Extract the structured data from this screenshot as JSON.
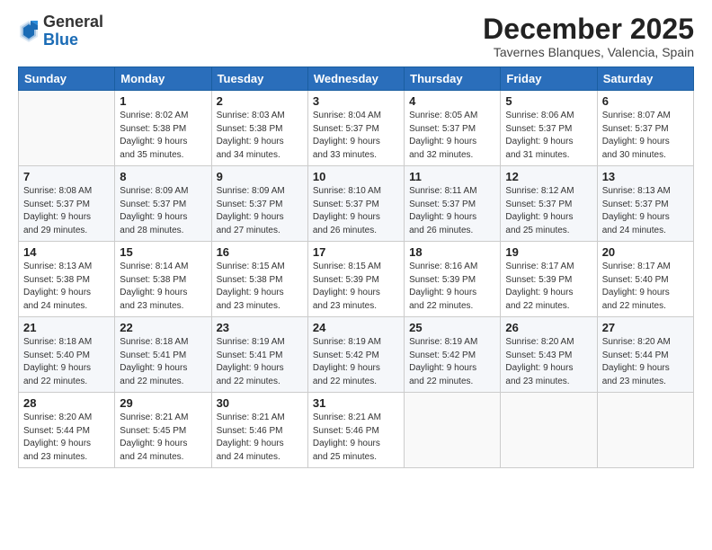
{
  "header": {
    "logo_general": "General",
    "logo_blue": "Blue",
    "month_title": "December 2025",
    "location": "Tavernes Blanques, Valencia, Spain"
  },
  "weekdays": [
    "Sunday",
    "Monday",
    "Tuesday",
    "Wednesday",
    "Thursday",
    "Friday",
    "Saturday"
  ],
  "weeks": [
    [
      {
        "day": "",
        "info": ""
      },
      {
        "day": "1",
        "info": "Sunrise: 8:02 AM\nSunset: 5:38 PM\nDaylight: 9 hours\nand 35 minutes."
      },
      {
        "day": "2",
        "info": "Sunrise: 8:03 AM\nSunset: 5:38 PM\nDaylight: 9 hours\nand 34 minutes."
      },
      {
        "day": "3",
        "info": "Sunrise: 8:04 AM\nSunset: 5:37 PM\nDaylight: 9 hours\nand 33 minutes."
      },
      {
        "day": "4",
        "info": "Sunrise: 8:05 AM\nSunset: 5:37 PM\nDaylight: 9 hours\nand 32 minutes."
      },
      {
        "day": "5",
        "info": "Sunrise: 8:06 AM\nSunset: 5:37 PM\nDaylight: 9 hours\nand 31 minutes."
      },
      {
        "day": "6",
        "info": "Sunrise: 8:07 AM\nSunset: 5:37 PM\nDaylight: 9 hours\nand 30 minutes."
      }
    ],
    [
      {
        "day": "7",
        "info": "Sunrise: 8:08 AM\nSunset: 5:37 PM\nDaylight: 9 hours\nand 29 minutes."
      },
      {
        "day": "8",
        "info": "Sunrise: 8:09 AM\nSunset: 5:37 PM\nDaylight: 9 hours\nand 28 minutes."
      },
      {
        "day": "9",
        "info": "Sunrise: 8:09 AM\nSunset: 5:37 PM\nDaylight: 9 hours\nand 27 minutes."
      },
      {
        "day": "10",
        "info": "Sunrise: 8:10 AM\nSunset: 5:37 PM\nDaylight: 9 hours\nand 26 minutes."
      },
      {
        "day": "11",
        "info": "Sunrise: 8:11 AM\nSunset: 5:37 PM\nDaylight: 9 hours\nand 26 minutes."
      },
      {
        "day": "12",
        "info": "Sunrise: 8:12 AM\nSunset: 5:37 PM\nDaylight: 9 hours\nand 25 minutes."
      },
      {
        "day": "13",
        "info": "Sunrise: 8:13 AM\nSunset: 5:37 PM\nDaylight: 9 hours\nand 24 minutes."
      }
    ],
    [
      {
        "day": "14",
        "info": "Sunrise: 8:13 AM\nSunset: 5:38 PM\nDaylight: 9 hours\nand 24 minutes."
      },
      {
        "day": "15",
        "info": "Sunrise: 8:14 AM\nSunset: 5:38 PM\nDaylight: 9 hours\nand 23 minutes."
      },
      {
        "day": "16",
        "info": "Sunrise: 8:15 AM\nSunset: 5:38 PM\nDaylight: 9 hours\nand 23 minutes."
      },
      {
        "day": "17",
        "info": "Sunrise: 8:15 AM\nSunset: 5:39 PM\nDaylight: 9 hours\nand 23 minutes."
      },
      {
        "day": "18",
        "info": "Sunrise: 8:16 AM\nSunset: 5:39 PM\nDaylight: 9 hours\nand 22 minutes."
      },
      {
        "day": "19",
        "info": "Sunrise: 8:17 AM\nSunset: 5:39 PM\nDaylight: 9 hours\nand 22 minutes."
      },
      {
        "day": "20",
        "info": "Sunrise: 8:17 AM\nSunset: 5:40 PM\nDaylight: 9 hours\nand 22 minutes."
      }
    ],
    [
      {
        "day": "21",
        "info": "Sunrise: 8:18 AM\nSunset: 5:40 PM\nDaylight: 9 hours\nand 22 minutes."
      },
      {
        "day": "22",
        "info": "Sunrise: 8:18 AM\nSunset: 5:41 PM\nDaylight: 9 hours\nand 22 minutes."
      },
      {
        "day": "23",
        "info": "Sunrise: 8:19 AM\nSunset: 5:41 PM\nDaylight: 9 hours\nand 22 minutes."
      },
      {
        "day": "24",
        "info": "Sunrise: 8:19 AM\nSunset: 5:42 PM\nDaylight: 9 hours\nand 22 minutes."
      },
      {
        "day": "25",
        "info": "Sunrise: 8:19 AM\nSunset: 5:42 PM\nDaylight: 9 hours\nand 22 minutes."
      },
      {
        "day": "26",
        "info": "Sunrise: 8:20 AM\nSunset: 5:43 PM\nDaylight: 9 hours\nand 23 minutes."
      },
      {
        "day": "27",
        "info": "Sunrise: 8:20 AM\nSunset: 5:44 PM\nDaylight: 9 hours\nand 23 minutes."
      }
    ],
    [
      {
        "day": "28",
        "info": "Sunrise: 8:20 AM\nSunset: 5:44 PM\nDaylight: 9 hours\nand 23 minutes."
      },
      {
        "day": "29",
        "info": "Sunrise: 8:21 AM\nSunset: 5:45 PM\nDaylight: 9 hours\nand 24 minutes."
      },
      {
        "day": "30",
        "info": "Sunrise: 8:21 AM\nSunset: 5:46 PM\nDaylight: 9 hours\nand 24 minutes."
      },
      {
        "day": "31",
        "info": "Sunrise: 8:21 AM\nSunset: 5:46 PM\nDaylight: 9 hours\nand 25 minutes."
      },
      {
        "day": "",
        "info": ""
      },
      {
        "day": "",
        "info": ""
      },
      {
        "day": "",
        "info": ""
      }
    ]
  ]
}
